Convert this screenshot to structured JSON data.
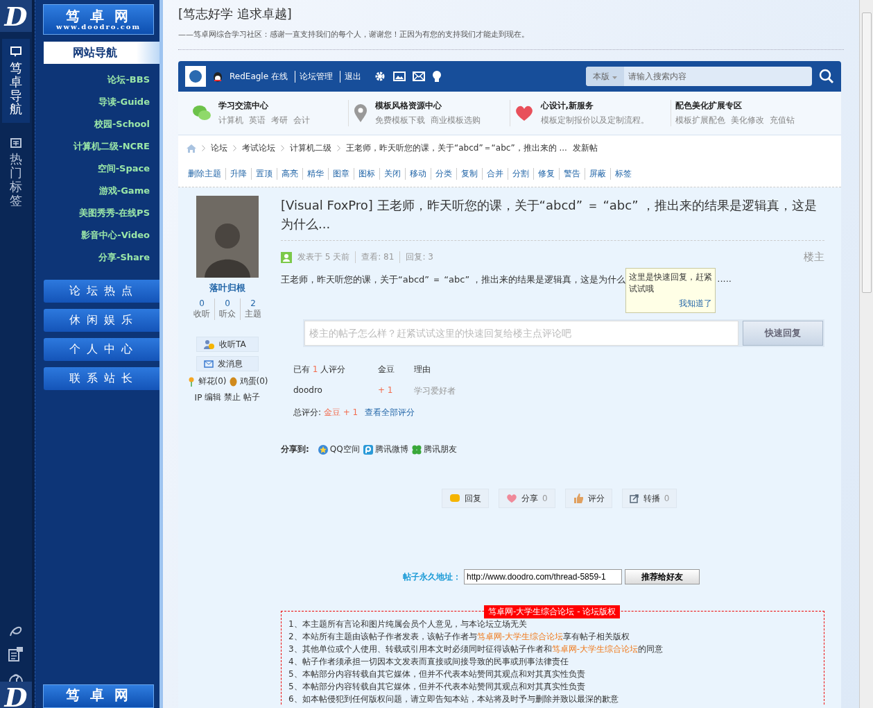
{
  "rail": {
    "logo": "D",
    "items": [
      {
        "label": "笃卓导航",
        "selected": true,
        "kind": "chat"
      },
      {
        "label": "热门标签",
        "selected": false,
        "kind": "news"
      }
    ],
    "bottom_logo": "D"
  },
  "nav": {
    "logo_title": "笃 卓 网",
    "logo_url": "www.doodro.com",
    "heading": "网站导航",
    "links": [
      "论坛-BBS",
      "导读-Guide",
      "校园-School",
      "计算机二级-NCRE",
      "空间-Space",
      "游戏-Game",
      "美图秀秀-在线PS",
      "影音中心-Video",
      "分享-Share"
    ],
    "sections": [
      "论 坛 热 点",
      "休 闲 娱 乐",
      "个 人 中 心",
      "联 系 站 长"
    ],
    "bottom_logo_title": "笃 卓 网"
  },
  "header": {
    "slogan": "[笃志好学 追求卓越]",
    "tagline": "——笃卓网综合学习社区：感谢一直支持我们的每个人，谢谢您！正因为有您的支持我们才能走到现在。"
  },
  "topbar": {
    "user": "RedEagle",
    "status": "在线",
    "links": [
      "论坛管理",
      "退出"
    ],
    "search_scope": "本版",
    "search_placeholder": "请输入搜索内容"
  },
  "categories": [
    {
      "title": "学习交流中心",
      "links": [
        "计算机",
        "英语",
        "考研",
        "会计"
      ],
      "kind": "chat"
    },
    {
      "title": "模板风格资源中心",
      "links": [
        "免费模板下载",
        "商业模板选购"
      ],
      "kind": "pin"
    },
    {
      "title": "心设计,新服务",
      "links": [
        "模板定制报价以及定制流程。"
      ],
      "kind": "heart"
    },
    {
      "title": "配色美化扩展专区",
      "links": [
        "模板扩展配色",
        "美化修改",
        "充值钻"
      ],
      "kind": "none"
    }
  ],
  "breadcrumb": [
    "论坛",
    "考试论坛",
    "计算机二级",
    "王老师，昨天听您的课，关于“abcd”＝“abc”，推出来的 ..."
  ],
  "new_post": "发新帖",
  "mod_actions": [
    "删除主题",
    "升降",
    "置顶",
    "高亮",
    "精华",
    "图章",
    "图标",
    "关闭",
    "移动",
    "分类",
    "复制",
    "合并",
    "分割",
    "修复",
    "警告",
    "屏蔽",
    "标签"
  ],
  "author": {
    "name": "落叶归根",
    "stats": [
      {
        "value": "0",
        "label": "收听"
      },
      {
        "value": "0",
        "label": "听众"
      },
      {
        "value": "2",
        "label": "主题"
      }
    ],
    "buttons": [
      {
        "label": "收听TA",
        "kind": "follow"
      },
      {
        "label": "发消息",
        "kind": "mail"
      }
    ],
    "flowers": "鲜花(0)",
    "eggs": "鸡蛋(0)",
    "admin_links": [
      "IP",
      "编辑",
      "禁止",
      "帖子"
    ]
  },
  "post": {
    "title": "[Visual FoxPro] 王老师，昨天听您的课，关于“abcd” ＝ “abc” ，推出来的结果是逻辑真，这是为什么...",
    "meta": [
      "发表于 5 天前",
      "查看: 81",
      "回复: 3"
    ],
    "floor": "楼主",
    "body": "王老师，昨天听您的课，关于“abcd” ＝ “abc” ，推出来的结果是逻辑真，这是为什么",
    "body_tail": ".....",
    "tooltip": {
      "text": "这里是快速回复，赶紧试试哦",
      "action": "我知道了"
    },
    "quick_reply": {
      "placeholder": "楼主的帖子怎么样？赶紧试试这里的快速回复给楼主点评论吧",
      "button": "快速回复"
    }
  },
  "ratings": {
    "prefix": "已有",
    "count": "1",
    "suffix": "人评分",
    "columns": [
      "金豆",
      "理由"
    ],
    "rows": [
      {
        "user": "doodro",
        "score": "+ 1",
        "reason": "学习爱好者"
      }
    ],
    "total_label": "总评分:",
    "total": "金豆 + 1",
    "view_all": "查看全部评分"
  },
  "share": {
    "label": "分享到:",
    "targets": [
      {
        "label": "QQ空间",
        "kind": "star"
      },
      {
        "label": "腾讯微博",
        "kind": "weibo"
      },
      {
        "label": "腾讯朋友",
        "kind": "clover"
      }
    ]
  },
  "actions": [
    {
      "label": "回复",
      "kind": "reply"
    },
    {
      "label": "分享",
      "count": "0",
      "kind": "heart"
    },
    {
      "label": "评分",
      "kind": "thumb"
    },
    {
      "label": "转播",
      "count": "0",
      "kind": "forward"
    }
  ],
  "permalink": {
    "label": "帖子永久地址：",
    "value": "http://www.doodro.com/thread-5859-1",
    "button": "推荐给好友"
  },
  "copyright": {
    "title": "笃卓网-大学生综合论坛 - 论坛版权",
    "items": [
      [
        {
          "text": "1、本主题所有言论和图片纯属会员个人意见，与本论坛立场无关",
          "highlight": false
        }
      ],
      [
        {
          "text": "2、本站所有主题由该帖子作者发表，该帖子作者与",
          "highlight": false
        },
        {
          "text": "笃卓网-大学生综合论坛",
          "highlight": true
        },
        {
          "text": "享有帖子相关版权",
          "highlight": false
        }
      ],
      [
        {
          "text": "3、其他单位或个人使用、转载或引用本文时必须同时征得该帖子作者和",
          "highlight": false
        },
        {
          "text": "笃卓网-大学生综合论坛",
          "highlight": true
        },
        {
          "text": "的同意",
          "highlight": false
        }
      ],
      [
        {
          "text": "4、帖子作者须承担一切因本文发表而直接或间接导致的民事或刑事法律责任",
          "highlight": false
        }
      ],
      [
        {
          "text": "5、本帖部分内容转载自其它媒体，但并不代表本站赞同其观点和对其真实性负责",
          "highlight": false
        }
      ],
      [
        {
          "text": "5、本帖部分内容转载自其它媒体，但并不代表本站赞同其观点和对其真实性负责",
          "highlight": false
        }
      ],
      [
        {
          "text": "6、如本帖侵犯到任何版权问题，请立即告知本站，本站将及时予与删除并致以最深的歉意",
          "highlight": false
        }
      ]
    ]
  }
}
